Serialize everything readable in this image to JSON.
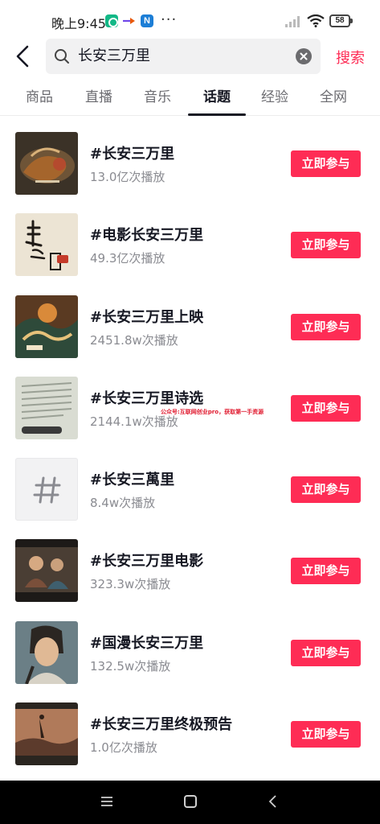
{
  "status_bar": {
    "time": "晚上9:45",
    "more": "···",
    "battery": "58"
  },
  "search": {
    "query": "长安三万里",
    "button_label": "搜索"
  },
  "tabs": [
    {
      "label": "商品",
      "active": false
    },
    {
      "label": "直播",
      "active": false
    },
    {
      "label": "音乐",
      "active": false
    },
    {
      "label": "话题",
      "active": true
    },
    {
      "label": "经验",
      "active": false
    },
    {
      "label": "全网",
      "active": false
    }
  ],
  "topics": [
    {
      "title": "#长安三万里",
      "plays": "13.0亿次播放",
      "button": "立即参与",
      "thumb": "poster-art"
    },
    {
      "title": "#电影长安三万里",
      "plays": "49.3亿次播放",
      "button": "立即参与",
      "thumb": "calligraphy-poster"
    },
    {
      "title": "#长安三万里上映",
      "plays": "2451.8w次播放",
      "button": "立即参与",
      "thumb": "movie-poster"
    },
    {
      "title": "#长安三万里诗选",
      "plays": "2144.1w次播放",
      "button": "立即参与",
      "thumb": "book-page"
    },
    {
      "title": "#长安三萬里",
      "plays": "8.4w次播放",
      "button": "立即参与",
      "thumb": "hashtag-placeholder"
    },
    {
      "title": "#长安三万里电影",
      "plays": "323.3w次播放",
      "button": "立即参与",
      "thumb": "movie-still"
    },
    {
      "title": "#国漫长安三万里",
      "plays": "132.5w次播放",
      "button": "立即参与",
      "thumb": "character-portrait"
    },
    {
      "title": "#长安三万里终极预告",
      "plays": "1.0亿次播放",
      "button": "立即参与",
      "thumb": "trailer-still"
    }
  ],
  "overlay_caption": "公众号:互联网创业pro，获取第一手资源",
  "icons": {
    "back": "chevron-left-icon",
    "search": "search-icon",
    "clear": "clear-icon",
    "hashtag": "hashtag-icon"
  },
  "colors": {
    "accent": "#fe2c55",
    "text": "#161823",
    "secondary": "#8a8b91"
  }
}
